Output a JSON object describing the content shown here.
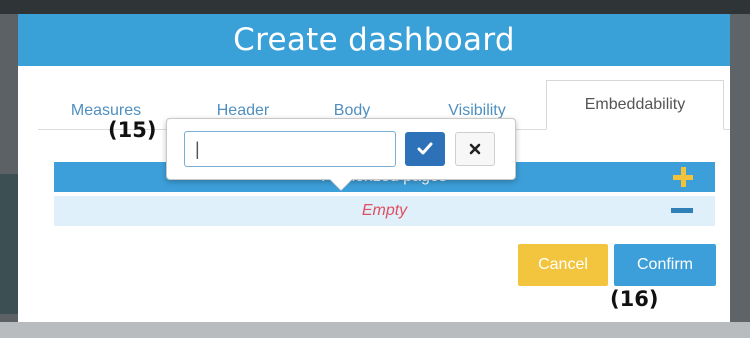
{
  "dialog": {
    "title": "Create dashboard"
  },
  "tabs": [
    {
      "label": "Measures"
    },
    {
      "label": "Header"
    },
    {
      "label": "Body"
    },
    {
      "label": "Visibility"
    },
    {
      "label": "Embeddability",
      "active": true
    }
  ],
  "list": {
    "header": "Authorized pages",
    "empty_text": "Empty",
    "add_icon": "plus-icon",
    "remove_icon": "minus-icon"
  },
  "popover": {
    "input_value": "|",
    "ok_icon": "check-icon",
    "cancel_icon": "close-icon"
  },
  "buttons": {
    "cancel": "Cancel",
    "confirm": "Confirm"
  },
  "annotations": {
    "first": "(15)",
    "second": "(16)"
  },
  "colors": {
    "primary": "#39a0d8",
    "warning": "#f3c53e",
    "danger_text": "#e04f61",
    "row_bg": "#dff0fa"
  }
}
